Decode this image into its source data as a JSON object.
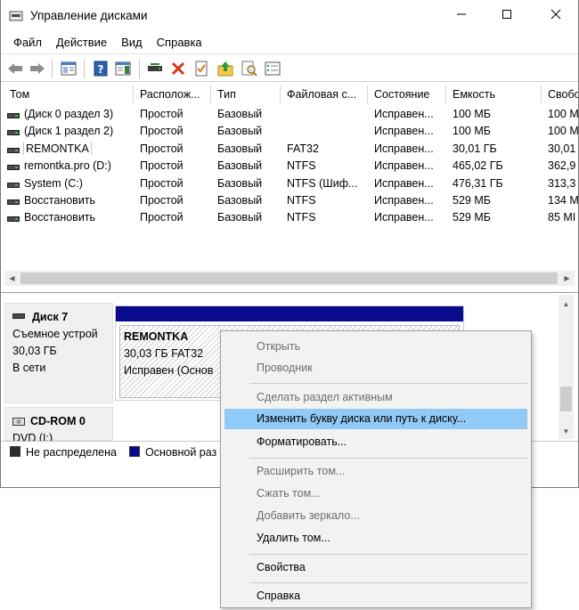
{
  "window": {
    "title": "Управление дисками",
    "icon": "disk-management-icon"
  },
  "menu": [
    "Файл",
    "Действие",
    "Вид",
    "Справка"
  ],
  "toolbar": {
    "icons": [
      "back-arrow-icon",
      "forward-arrow-icon",
      "console-tree-icon",
      "help-icon",
      "action-pane-icon",
      "connect-icon",
      "delete-icon",
      "properties-icon",
      "upload-icon",
      "search-icon",
      "list-icon"
    ]
  },
  "volumes": {
    "columns": [
      "Том",
      "Располож...",
      "Тип",
      "Файловая с...",
      "Состояние",
      "Емкость",
      "Свобо"
    ],
    "rows": [
      [
        "(Диск 0 раздел 3)",
        "Простой",
        "Базовый",
        "",
        "Исправен...",
        "100 МБ",
        "100 М"
      ],
      [
        "(Диск 1 раздел 2)",
        "Простой",
        "Базовый",
        "",
        "Исправен...",
        "100 МБ",
        "100 М"
      ],
      [
        "REMONTKA",
        "Простой",
        "Базовый",
        "FAT32",
        "Исправен...",
        "30,01 ГБ",
        "30,01"
      ],
      [
        "remontka.pro (D:)",
        "Простой",
        "Базовый",
        "NTFS",
        "Исправен...",
        "465,02 ГБ",
        "362,9"
      ],
      [
        "System (C:)",
        "Простой",
        "Базовый",
        "NTFS (Шиф...",
        "Исправен...",
        "476,31 ГБ",
        "313,3"
      ],
      [
        "Восстановить",
        "Простой",
        "Базовый",
        "NTFS",
        "Исправен...",
        "529 МБ",
        "134 М"
      ],
      [
        "Восстановить",
        "Простой",
        "Базовый",
        "NTFS",
        "Исправен...",
        "529 МБ",
        "85 МI"
      ]
    ]
  },
  "disks": {
    "disk7": {
      "name": "Диск 7",
      "type": "Съемное устрой",
      "size": "30,03 ГБ",
      "status": "В сети",
      "partition": {
        "name": "REMONTKA",
        "size_fs": "30,03 ГБ FAT32",
        "state": "Исправен (Основ"
      }
    },
    "cdrom": {
      "name": "CD-ROM 0",
      "drive": "DVD (I:)"
    }
  },
  "legend": {
    "unallocated": "Не распределена",
    "primary": "Основной раз",
    "unallocated_color": "#2b2b2b",
    "primary_color": "#0a0a8c"
  },
  "context_menu": {
    "items": [
      {
        "label": "Открыть",
        "enabled": false
      },
      {
        "label": "Проводник",
        "enabled": false
      },
      {
        "label": "Сделать раздел активным",
        "enabled": false
      },
      {
        "label": "Изменить букву диска или путь к диску...",
        "enabled": true,
        "highlighted": true
      },
      {
        "label": "Форматировать...",
        "enabled": true
      },
      {
        "label": "Расширить том...",
        "enabled": false
      },
      {
        "label": "Сжать том...",
        "enabled": false
      },
      {
        "label": "Добавить зеркало...",
        "enabled": false
      },
      {
        "label": "Удалить том...",
        "enabled": true
      },
      {
        "label": "Свойства",
        "enabled": true
      },
      {
        "label": "Справка",
        "enabled": true
      }
    ],
    "highlight_color": "#91c9f7"
  }
}
